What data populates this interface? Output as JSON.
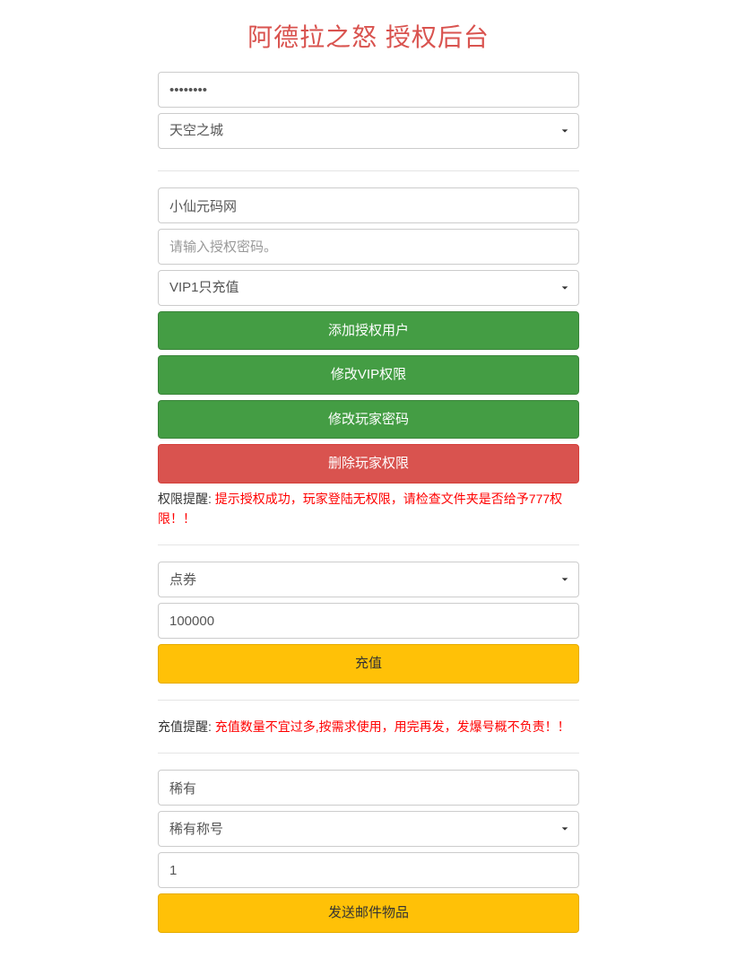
{
  "title": "阿德拉之怒 授权后台",
  "section1": {
    "password_value": "••••••••",
    "server_select": "天空之城"
  },
  "section2": {
    "username_value": "小仙元码网",
    "auth_password_placeholder": "请输入授权密码。",
    "vip_select": "VIP1只充值",
    "btn_add_user": "添加授权用户",
    "btn_modify_vip": "修改VIP权限",
    "btn_modify_password": "修改玩家密码",
    "btn_delete_permission": "删除玩家权限",
    "notice_label": "权限提醒: ",
    "notice_text": "提示授权成功，玩家登陆无权限，请检查文件夹是否给予777权限！！"
  },
  "section3": {
    "currency_select": "点券",
    "amount_value": "100000",
    "btn_recharge": "充值"
  },
  "section4": {
    "notice_label": "充值提醒: ",
    "notice_text": "充值数量不宜过多,按需求使用，用完再发，发爆号概不负责！！"
  },
  "section5": {
    "rarity_value": "稀有",
    "title_select": "稀有称号",
    "quantity_value": "1",
    "btn_send_mail": "发送邮件物品"
  }
}
